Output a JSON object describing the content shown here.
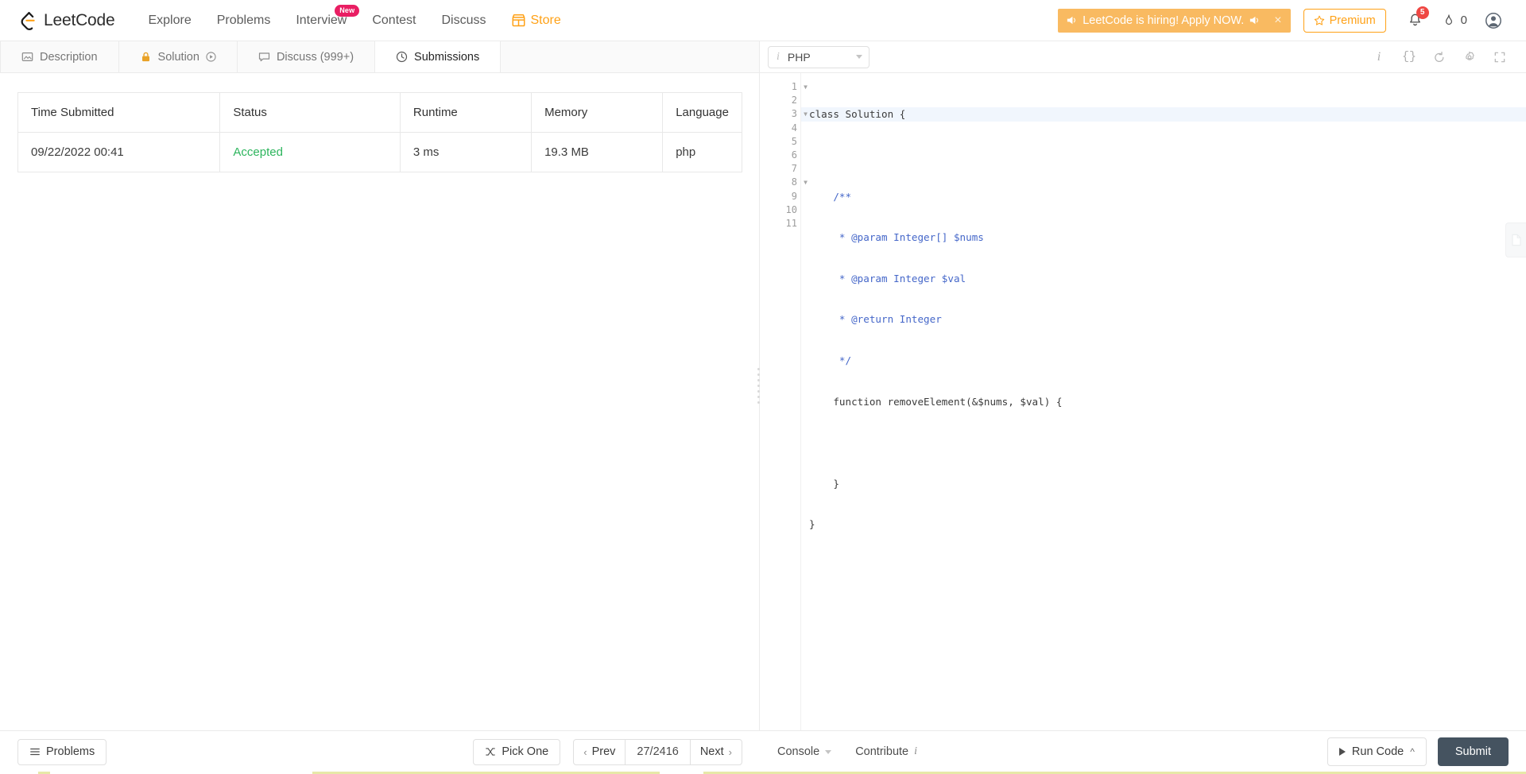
{
  "brand": {
    "name": "LeetCode",
    "logo_icon": "leetcode-logo-icon"
  },
  "nav": {
    "links": [
      {
        "label": "Explore",
        "badge": null
      },
      {
        "label": "Problems",
        "badge": null
      },
      {
        "label": "Interview",
        "badge": "New"
      },
      {
        "label": "Contest",
        "badge": null
      },
      {
        "label": "Discuss",
        "badge": null
      }
    ],
    "store": {
      "label": "Store",
      "icon": "store-icon"
    },
    "hiring_banner": {
      "text": "LeetCode is hiring! Apply NOW.",
      "speaker_icon": "speaker-icon",
      "close_icon": "close-icon",
      "bg_color": "#f9ba61"
    },
    "premium": {
      "label": "Premium",
      "icon": "star-icon",
      "color": "#ffa116"
    },
    "notifications": {
      "icon": "bell-icon",
      "count": "5",
      "badge_color": "#ef4743"
    },
    "streak": {
      "icon": "flame-icon",
      "count": "0"
    },
    "avatar": {
      "icon": "user-avatar-icon"
    }
  },
  "tabs": [
    {
      "label": "Description",
      "icon": "description-icon",
      "active": false,
      "locked": false
    },
    {
      "label": "Solution",
      "icon": "lock-icon",
      "active": false,
      "locked": true,
      "play_icon": "play-circle-icon"
    },
    {
      "label": "Discuss (999+)",
      "icon": "discuss-icon",
      "active": false,
      "locked": false
    },
    {
      "label": "Submissions",
      "icon": "clock-icon",
      "active": true,
      "locked": false
    }
  ],
  "submissions_table": {
    "columns": [
      "Time Submitted",
      "Status",
      "Runtime",
      "Memory",
      "Language"
    ],
    "rows": [
      {
        "time": "09/22/2022 00:41",
        "status": "Accepted",
        "status_color": "#2db55d",
        "runtime": "3 ms",
        "memory": "19.3 MB",
        "language": "php"
      }
    ]
  },
  "editor": {
    "language_select": {
      "value": "PHP",
      "info_icon": "info-icon",
      "caret_icon": "chevron-down-icon"
    },
    "tools": [
      {
        "name": "info-icon",
        "glyph": "i"
      },
      {
        "name": "format-braces-icon",
        "glyph": "{}"
      },
      {
        "name": "reset-code-icon",
        "glyph": "↺"
      },
      {
        "name": "settings-gear-icon",
        "glyph": "⚙"
      },
      {
        "name": "fullscreen-icon",
        "glyph": "⛶"
      }
    ],
    "line_numbers": [
      "1",
      "2",
      "3",
      "4",
      "5",
      "6",
      "7",
      "8",
      "9",
      "10",
      "11"
    ],
    "fold_lines": [
      1,
      3,
      8
    ],
    "highlight_line": 1,
    "code": [
      "class Solution {",
      "",
      "    /**",
      "     * @param Integer[] $nums",
      "     * @param Integer $val",
      "     * @return Integer",
      "     */",
      "    function removeElement(&$nums, $val) {",
      "",
      "    }",
      "}"
    ],
    "note_tab_icon": "note-page-icon"
  },
  "bottom_bar": {
    "problems": {
      "label": "Problems",
      "icon": "list-icon"
    },
    "pick_one": {
      "label": "Pick One",
      "icon": "shuffle-icon"
    },
    "prev": {
      "label": "Prev",
      "icon": "chevron-left-icon"
    },
    "page_count": "27/2416",
    "next": {
      "label": "Next",
      "icon": "chevron-right-icon"
    },
    "console": {
      "label": "Console",
      "caret_icon": "caret-down-icon"
    },
    "contribute": {
      "label": "Contribute",
      "info_icon": "info-italic-icon"
    },
    "run_code": {
      "label": "Run Code",
      "play_icon": "play-icon",
      "caret_icon": "chevron-up-icon"
    },
    "submit": {
      "label": "Submit",
      "bg_color": "#455360"
    }
  }
}
